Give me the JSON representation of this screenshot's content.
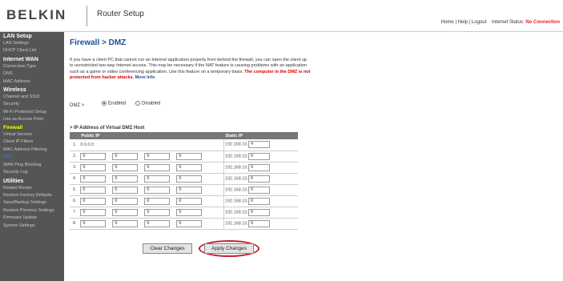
{
  "header": {
    "logo": "BELKIN",
    "app_title": "Router Setup",
    "links": {
      "home": "Home",
      "help": "Help",
      "logout": "Logout",
      "sep": "|"
    },
    "status_label": "Internet Status:",
    "status_value": "No Connection"
  },
  "sidebar": {
    "lan_setup": {
      "title": "LAN Setup",
      "items": [
        "LAN Settings",
        "DHCP Client List"
      ]
    },
    "internet_wan": {
      "title": "Internet WAN",
      "items": [
        "Connection Type",
        "DNS",
        "MAC Address"
      ]
    },
    "wireless": {
      "title": "Wireless",
      "items": [
        "Channel and SSID",
        "Security",
        "Wi-Fi Protected Setup",
        "Use as Access Point"
      ]
    },
    "firewall": {
      "title": "Firewall",
      "items": [
        "Virtual Servers",
        "Client IP Filters",
        "MAC Address Filtering",
        "DMZ",
        "WAN Ping Blocking",
        "Security Log"
      ]
    },
    "utilities": {
      "title": "Utilities",
      "items": [
        "Restart Router",
        "Restore Factory Defaults",
        "Save/Backup Settings",
        "Restore Previous Settings",
        "Firmware Update",
        "System Settings"
      ]
    }
  },
  "main": {
    "title": "Firewall > DMZ",
    "intro": "If you have a client PC that cannot run an Internet application properly from behind the firewall, you can open the client up to unrestricted two-way Internet access. This may be necessary if the NAT feature is causing problems with an application such as a game or video conferencing application. Use this feature on a temporary basis.",
    "warning": "The computer in the DMZ is not protected from hacker attacks.",
    "more_info": "More Info",
    "dmz_label": "DMZ >",
    "enabled_label": "Enabled",
    "disabled_label": "Disabled",
    "dmz_state": "Enabled",
    "host_heading": "> IP Address of Virtual DMZ Host",
    "table": {
      "col_public": "Public IP",
      "col_static": "Static IP",
      "static_prefix": "192.168.10.",
      "rows": [
        {
          "num": "1.",
          "public_text": "0.0.0.0",
          "static_last": "4"
        },
        {
          "num": "2.",
          "public": [
            "0",
            "0",
            "0",
            "0"
          ],
          "static_last": "0"
        },
        {
          "num": "3.",
          "public": [
            "0",
            "0",
            "0",
            "0"
          ],
          "static_last": "0"
        },
        {
          "num": "4.",
          "public": [
            "0",
            "0",
            "0",
            "0"
          ],
          "static_last": "0"
        },
        {
          "num": "5.",
          "public": [
            "0",
            "0",
            "0",
            "0"
          ],
          "static_last": "0"
        },
        {
          "num": "6.",
          "public": [
            "0",
            "0",
            "0",
            "0"
          ],
          "static_last": "0"
        },
        {
          "num": "7.",
          "public": [
            "0",
            "0",
            "0",
            "0"
          ],
          "static_last": "0"
        },
        {
          "num": "8.",
          "public": [
            "0",
            "0",
            "0",
            "0"
          ],
          "static_last": "0"
        }
      ]
    },
    "clear_button": "Clear Changes",
    "apply_button": "Apply Changes"
  },
  "colors": {
    "status_red": "#e8222a",
    "title_blue": "#1f4f8f",
    "sidebar_bg": "#555555",
    "active_yellow": "#ffff00"
  }
}
